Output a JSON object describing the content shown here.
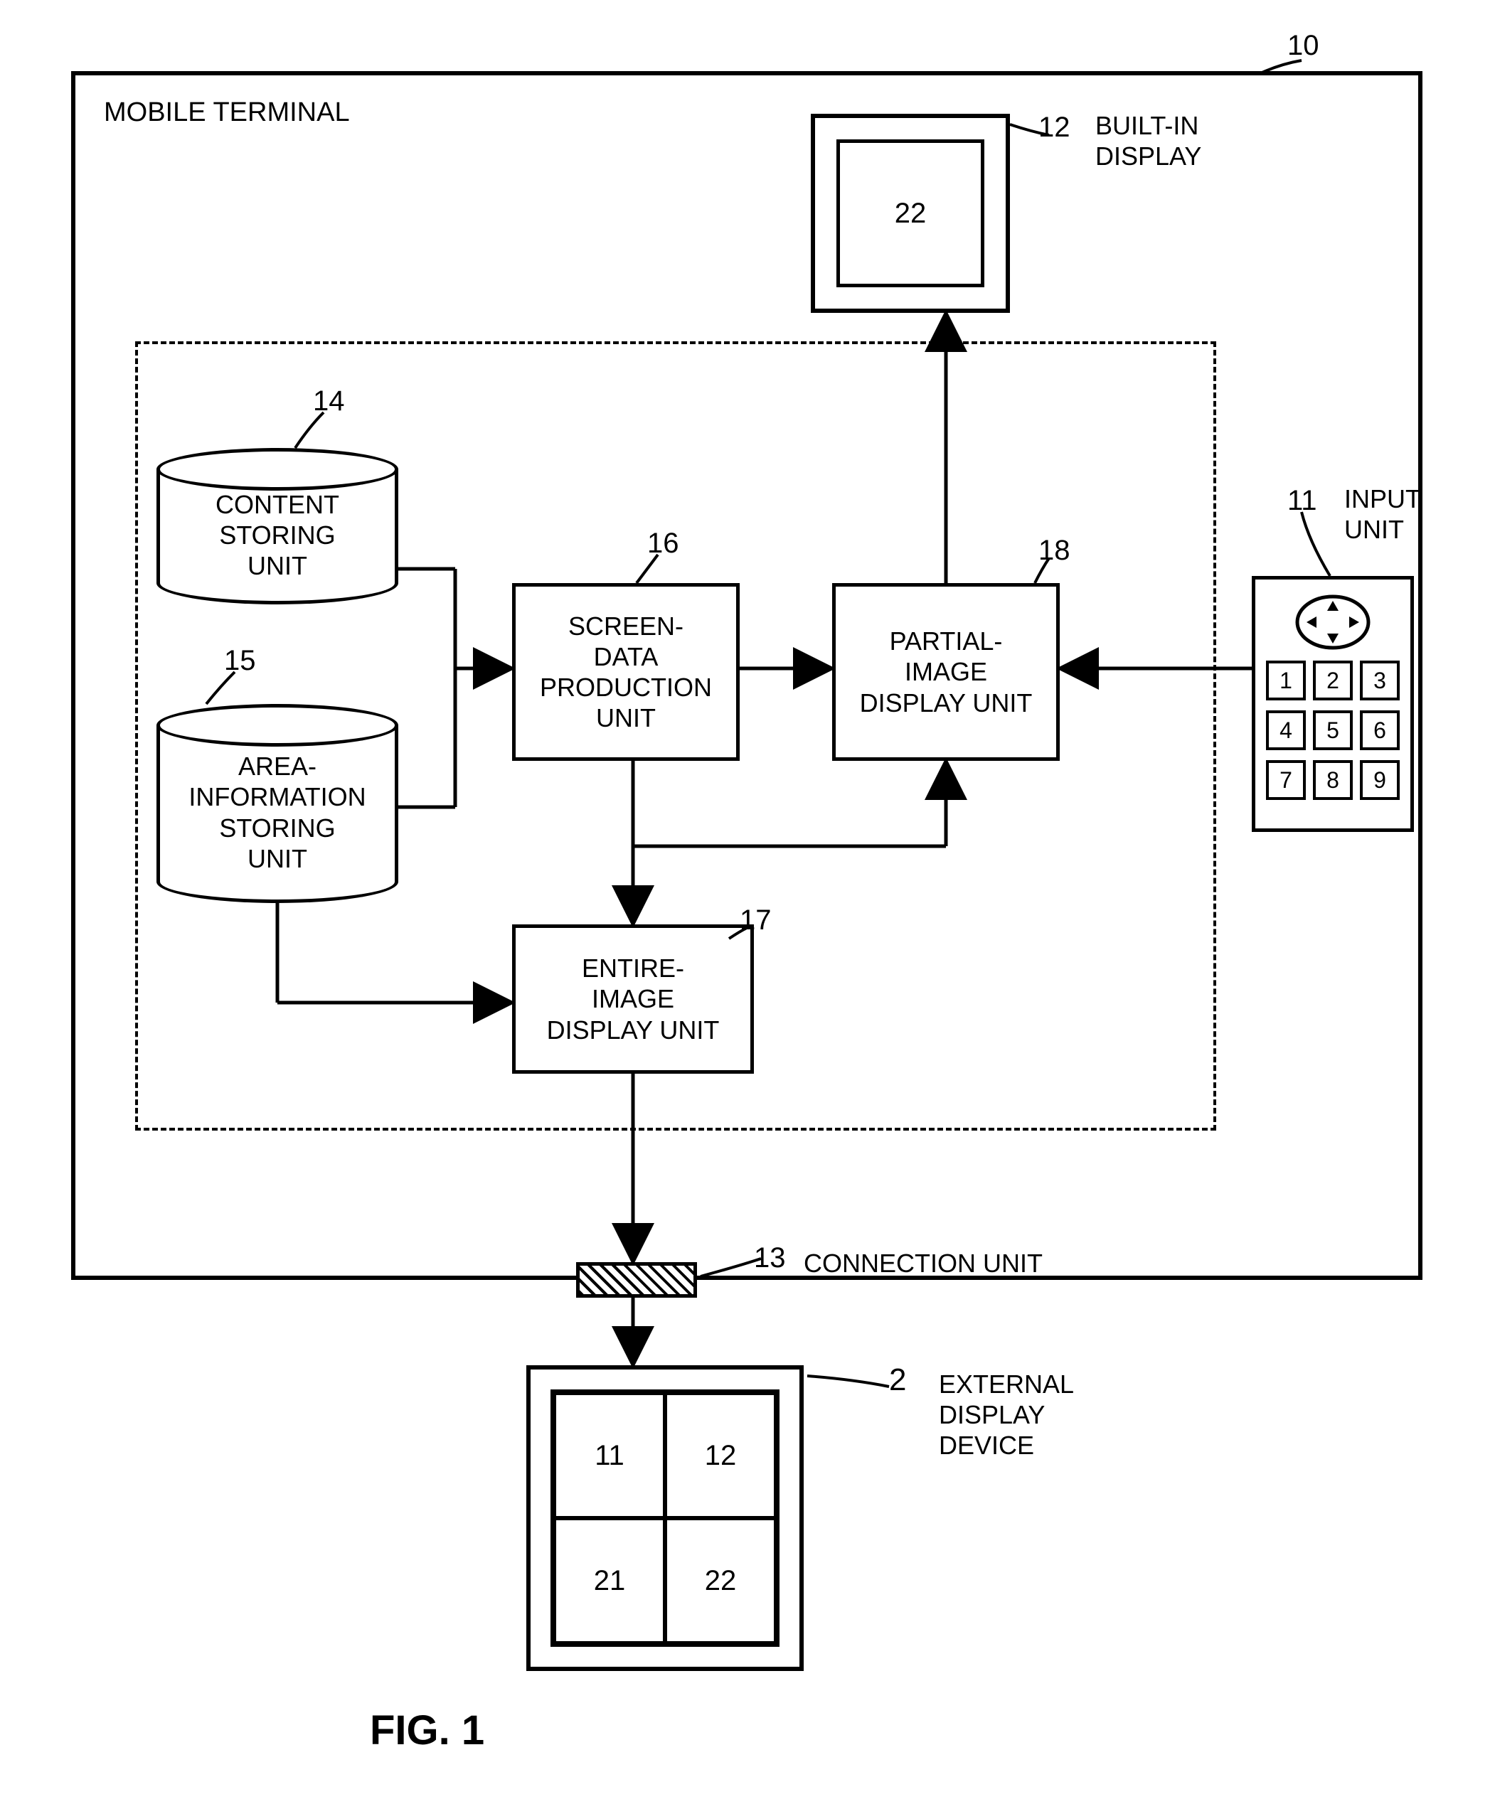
{
  "title": "MOBILE TERMINAL",
  "figure": "FIG. 1",
  "refs": {
    "terminal": "10",
    "input_unit": "11",
    "builtin_display": "12",
    "connection_unit": "13",
    "content_storing": "14",
    "area_info_storing": "15",
    "screen_data_production": "16",
    "entire_image_display": "17",
    "partial_image_display": "18",
    "external_display": "2",
    "builtin_display_value": "22"
  },
  "labels": {
    "builtin_display": "BUILT-IN\nDISPLAY",
    "input_unit": "INPUT\nUNIT",
    "content_storing": "CONTENT\nSTORING\nUNIT",
    "area_info_storing": "AREA-\nINFORMATION\nSTORING\nUNIT",
    "screen_data_production": "SCREEN-\nDATA\nPRODUCTION\nUNIT",
    "entire_image_display": "ENTIRE-\nIMAGE\nDISPLAY UNIT",
    "partial_image_display": "PARTIAL-\nIMAGE\nDISPLAY UNIT",
    "connection_unit": "CONNECTION UNIT",
    "external_display": "EXTERNAL\nDISPLAY\nDEVICE"
  },
  "keypad": {
    "rows": [
      [
        "1",
        "2",
        "3"
      ],
      [
        "4",
        "5",
        "6"
      ],
      [
        "7",
        "8",
        "9"
      ]
    ]
  },
  "ext_cells": [
    "11",
    "12",
    "21",
    "22"
  ]
}
